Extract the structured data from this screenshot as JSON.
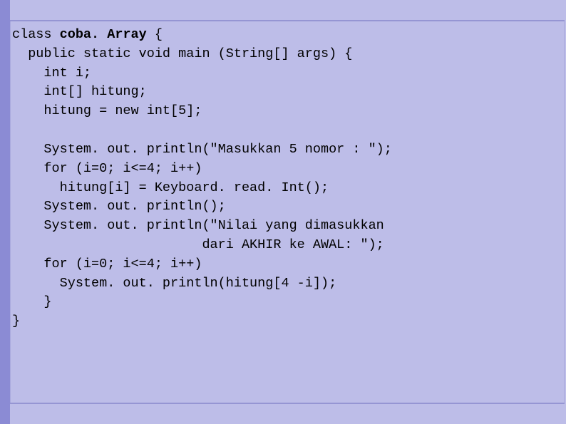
{
  "code": {
    "l1a": "class ",
    "l1b": "coba. Array",
    "l1c": " {",
    "l2": "  public static void main (String[] args) {",
    "l3": "    int i;",
    "l4": "    int[] hitung;",
    "l5": "    hitung = new int[5];",
    "l6": "",
    "l7": "    System. out. println(\"Masukkan 5 nomor : \");",
    "l8": "    for (i=0; i<=4; i++)",
    "l9": "      hitung[i] = Keyboard. read. Int();",
    "l10": "    System. out. println();",
    "l11": "    System. out. println(\"Nilai yang dimasukkan",
    "l12": "                        dari AKHIR ke AWAL: \");",
    "l13": "    for (i=0; i<=4; i++)",
    "l14": "      System. out. println(hitung[4 -i]);",
    "l15": "    }",
    "l16": "}"
  }
}
